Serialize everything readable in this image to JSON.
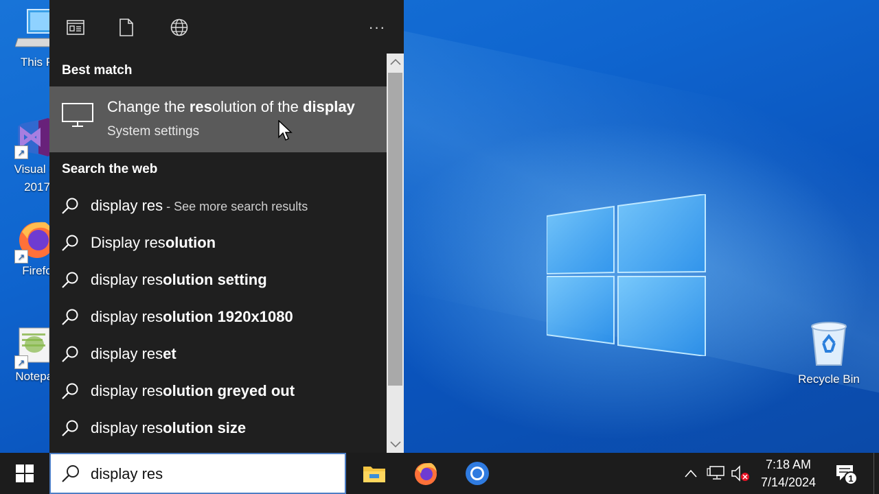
{
  "desktop": {
    "icons": [
      {
        "label": "This P",
        "name": "this-pc"
      },
      {
        "label": "Visual St",
        "label2": "2017",
        "name": "visual-studio"
      },
      {
        "label": "Firefo",
        "name": "firefox"
      },
      {
        "label": "Notepac",
        "name": "notepad"
      },
      {
        "label": "Recycle Bin",
        "name": "recycle-bin"
      }
    ]
  },
  "search_panel": {
    "toolbar": {
      "icons": [
        "apps-filter-icon",
        "documents-filter-icon",
        "web-filter-icon",
        "more-options-icon"
      ],
      "more_label": "···"
    },
    "best_match_header": "Best match",
    "best_match": {
      "icon": "monitor-icon",
      "title_parts": [
        "Change the ",
        "res",
        "olution of the ",
        "display"
      ],
      "subtitle": "System settings"
    },
    "web_header": "Search the web",
    "web_results": [
      {
        "query": "display res",
        "bold": "",
        "suffix": " - See more search results"
      },
      {
        "query": "Display res",
        "bold": "olution",
        "suffix": ""
      },
      {
        "query": "display res",
        "bold": "olution setting",
        "suffix": ""
      },
      {
        "query": "display res",
        "bold": "olution 1920x1080",
        "suffix": ""
      },
      {
        "query": "display res",
        "bold": "et",
        "suffix": ""
      },
      {
        "query": "display res",
        "bold": "olution greyed out",
        "suffix": ""
      },
      {
        "query": "display res",
        "bold": "olution size",
        "suffix": ""
      }
    ]
  },
  "taskbar": {
    "search_value": "display res",
    "apps": [
      "file-explorer-icon",
      "firefox-icon",
      "chrome-icon"
    ],
    "tray": {
      "show_hidden": "^",
      "time": "7:18 AM",
      "date": "7/14/2024",
      "notification_count": "1"
    }
  },
  "colors": {
    "panel_bg": "#1f1f1f",
    "highlight_bg": "#5a5a5a",
    "taskbar_bg": "#1c1c1c",
    "wallpaper_blue": "#0f65cf"
  }
}
